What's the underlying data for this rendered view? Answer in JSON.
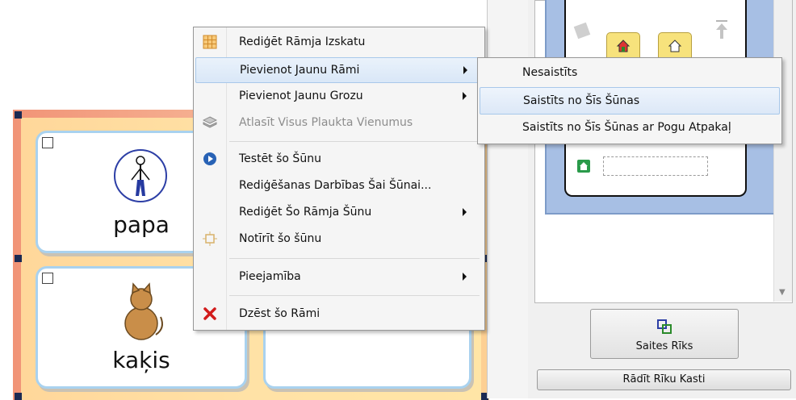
{
  "context_menu": {
    "items": [
      {
        "label": "Rediģēt Rāmja Izskatu",
        "icon": "grid-icon",
        "submenu": false
      },
      {
        "label": "Pievienot Jaunu Rāmi",
        "icon": "",
        "submenu": true,
        "highlighted": true
      },
      {
        "label": "Pievienot Jaunu Grozu",
        "icon": "",
        "submenu": true
      },
      {
        "label": "Atlasīt Visus Plaukta Vienumus",
        "icon": "stack-icon",
        "submenu": false,
        "disabled": true
      },
      {
        "label": "Testēt šo Šūnu",
        "icon": "play-icon",
        "submenu": false
      },
      {
        "label": "Rediģēšanas Darbības Šai Šūnai...",
        "icon": "",
        "submenu": false
      },
      {
        "label": "Rediģēt Šo Rāmja Šūnu",
        "icon": "",
        "submenu": true
      },
      {
        "label": "Notīrīt šo šūnu",
        "icon": "clear-icon",
        "submenu": false
      },
      {
        "label": "Pieejamība",
        "icon": "",
        "submenu": true
      },
      {
        "label": "Dzēst šo Rāmi",
        "icon": "delete-icon",
        "submenu": false
      }
    ]
  },
  "submenu": {
    "items": [
      {
        "label": "Nesaistīts"
      },
      {
        "label": "Saistīts no Šīs Šūnas",
        "highlighted": true
      },
      {
        "label": "Saistīts no Šīs Šūnas ar Pogu Atpakaļ"
      }
    ]
  },
  "cells": [
    {
      "word": "papa",
      "symbol": "person-icon"
    },
    {
      "word": "kaķis",
      "symbol": "cat-icon"
    }
  ],
  "right_panel": {
    "link_tool_label": "Saites Rīks",
    "show_toolbox_label": "Rādīt Rīku Kasti"
  },
  "colors": {
    "menu_bg": "#f5f5f5",
    "highlight": "#d9e7f7",
    "frame_pink": "#f19477",
    "frame_yellow": "#ffe2a6",
    "cell_border": "#a9d2ef",
    "delete_red": "#d21c1c",
    "play_blue": "#2862b5"
  }
}
